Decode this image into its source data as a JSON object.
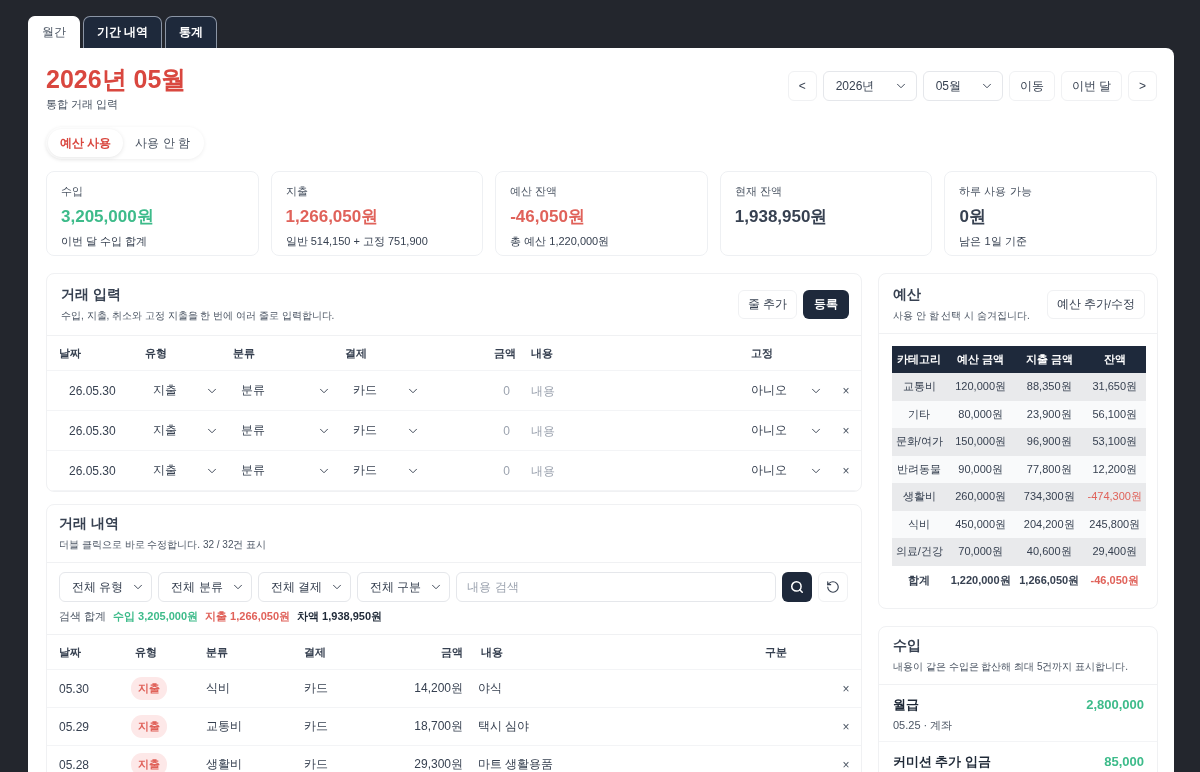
{
  "tabs": [
    {
      "label": "월간",
      "selected": true
    },
    {
      "label": "기간 내역",
      "selected": false
    },
    {
      "label": "통계",
      "selected": false
    }
  ],
  "header": {
    "title": "2026년 05월",
    "subtitle": "통합 거래 입력",
    "nav": {
      "prev": "<",
      "year": "2026년",
      "month": "05월",
      "go": "이동",
      "this_month": "이번 달",
      "next": ">"
    }
  },
  "budget_mode": [
    {
      "label": "예산 사용",
      "selected": true
    },
    {
      "label": "사용 안 함",
      "selected": false
    }
  ],
  "summary": [
    {
      "label": "수입",
      "value": "3,205,000원",
      "note": "이번 달 수입 합계",
      "color": "#3dbb8a"
    },
    {
      "label": "지출",
      "value": "1,266,050원",
      "note": "일반 514,150 + 고정 751,900",
      "color": "#e0625a"
    },
    {
      "label": "예산 잔액",
      "value": "-46,050원",
      "note": "총 예산 1,220,000원",
      "color": "#e0625a"
    },
    {
      "label": "현재 잔액",
      "value": "1,938,950원",
      "color": "#374151"
    },
    {
      "label": "하루 사용 가능",
      "value": "0원",
      "note": "남은 1일 기준",
      "color": "#374151"
    }
  ],
  "entry": {
    "title": "거래 입력",
    "description": "수입, 지출, 취소와 고정 지출을 한 번에 여러 줄로 입력합니다.",
    "add_row": "줄 추가",
    "submit": "등록",
    "columns": [
      "날짜",
      "유형",
      "분류",
      "결제",
      "금액",
      "내용",
      "고정"
    ],
    "rows": [
      {
        "date": "26.05.30",
        "type": "지출",
        "category": "분류",
        "payment": "카드",
        "amount_placeholder": "0",
        "memo_placeholder": "내용",
        "fixed": "아니오",
        "remove": "×"
      },
      {
        "date": "26.05.30",
        "type": "지출",
        "category": "분류",
        "payment": "카드",
        "amount_placeholder": "0",
        "memo_placeholder": "내용",
        "fixed": "아니오",
        "remove": "×"
      },
      {
        "date": "26.05.30",
        "type": "지출",
        "category": "분류",
        "payment": "카드",
        "amount_placeholder": "0",
        "memo_placeholder": "내용",
        "fixed": "아니오",
        "remove": "×"
      }
    ]
  },
  "history": {
    "title": "거래 내역",
    "description": "더블 클릭으로 바로 수정합니다. 32 / 32건 표시",
    "filters": [
      "전체 유형",
      "전체 분류",
      "전체 결제",
      "전체 구분"
    ],
    "search_placeholder": "내용 검색",
    "totals": {
      "label": "검색 합계",
      "income": "수입 3,205,000원",
      "expense": "지출 1,266,050원",
      "difference": "차액 1,938,950원"
    },
    "columns": [
      "날짜",
      "유형",
      "분류",
      "결제",
      "금액",
      "내용",
      "구분"
    ],
    "rows": [
      {
        "date": "05.30",
        "type": "지출",
        "category": "식비",
        "payment": "카드",
        "amount": "14,200원",
        "memo": "야식",
        "remove": "×"
      },
      {
        "date": "05.29",
        "type": "지출",
        "category": "교통비",
        "payment": "카드",
        "amount": "18,700원",
        "memo": "택시 심야",
        "remove": "×"
      },
      {
        "date": "05.28",
        "type": "지출",
        "category": "생활비",
        "payment": "카드",
        "amount": "29,300원",
        "memo": "마트 생활용품",
        "remove": "×"
      }
    ]
  },
  "budget": {
    "title": "예산",
    "description": "사용 안 함 선택 시 숨겨집니다.",
    "button": "예산 추가/수정",
    "columns": [
      "카테고리",
      "예산 금액",
      "지출 금액",
      "잔액"
    ],
    "rows": [
      {
        "category": "교통비",
        "budget": "120,000원",
        "spent": "88,350원",
        "remaining": "31,650원",
        "over": false
      },
      {
        "category": "기타",
        "budget": "80,000원",
        "spent": "23,900원",
        "remaining": "56,100원",
        "over": false
      },
      {
        "category": "문화/여가",
        "budget": "150,000원",
        "spent": "96,900원",
        "remaining": "53,100원",
        "over": false
      },
      {
        "category": "반려동물",
        "budget": "90,000원",
        "spent": "77,800원",
        "remaining": "12,200원",
        "over": false
      },
      {
        "category": "생활비",
        "budget": "260,000원",
        "spent": "734,300원",
        "remaining": "-474,300원",
        "over": true
      },
      {
        "category": "식비",
        "budget": "450,000원",
        "spent": "204,200원",
        "remaining": "245,800원",
        "over": false
      },
      {
        "category": "의료/건강",
        "budget": "70,000원",
        "spent": "40,600원",
        "remaining": "29,400원",
        "over": false
      }
    ],
    "total": {
      "label": "합계",
      "budget": "1,220,000원",
      "spent": "1,266,050원",
      "remaining": "-46,050원",
      "over": true
    }
  },
  "income": {
    "title": "수입",
    "description": "내용이 같은 수입은 합산해 최대 5건까지 표시합니다.",
    "items": [
      {
        "name": "월급",
        "meta": "05.25 · 계좌",
        "amount": "2,800,000"
      },
      {
        "name": "커미션 추가 입금",
        "amount": "85,000"
      }
    ]
  }
}
